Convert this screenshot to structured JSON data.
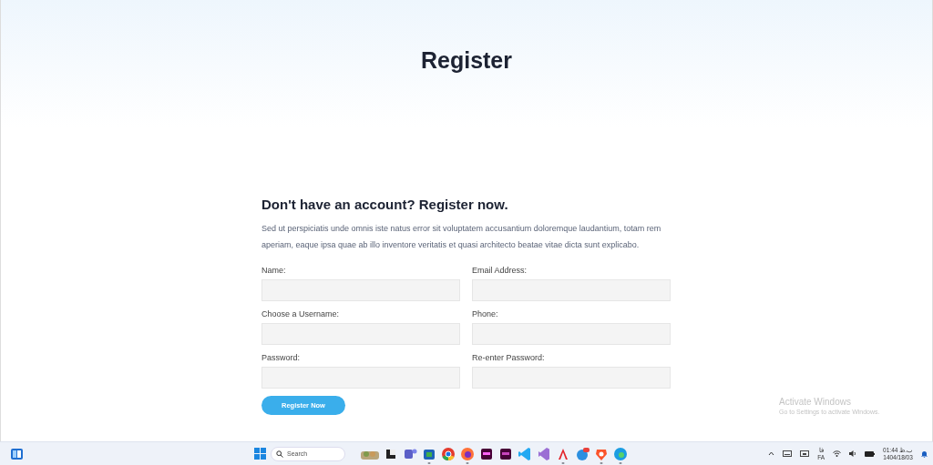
{
  "page": {
    "title": "Register"
  },
  "form": {
    "heading": "Don't have an account? Register now.",
    "intro": "Sed ut perspiciatis unde omnis iste natus error sit voluptatem accusantium doloremque laudantium, totam rem aperiam, eaque ipsa quae ab illo inventore veritatis et quasi architecto beatae vitae dicta sunt explicabo.",
    "fields": [
      {
        "label": "Name:"
      },
      {
        "label": "Email Address:"
      },
      {
        "label": "Choose a Username:"
      },
      {
        "label": "Phone:"
      },
      {
        "label": "Password:"
      },
      {
        "label": "Re-enter Password:"
      }
    ],
    "submit": "Register Now"
  },
  "activation_notice": {
    "title": "Activate Windows",
    "text": "Go to Settings to activate Windows."
  },
  "taskbar": {
    "search": {
      "placeholder": "Search"
    },
    "apps": [
      {
        "running": false
      },
      {
        "running": false
      },
      {
        "running": false
      },
      {
        "running": true
      },
      {
        "running": false
      },
      {
        "running": true
      },
      {
        "running": false
      },
      {
        "running": false
      },
      {
        "running": false
      },
      {
        "running": false
      },
      {
        "running": true
      },
      {
        "running": false
      },
      {
        "running": true
      },
      {
        "running": true
      }
    ],
    "language": {
      "script": "فا",
      "code": "FA"
    },
    "time": "ب.ظ 01:44",
    "date": "1404/18/03"
  }
}
